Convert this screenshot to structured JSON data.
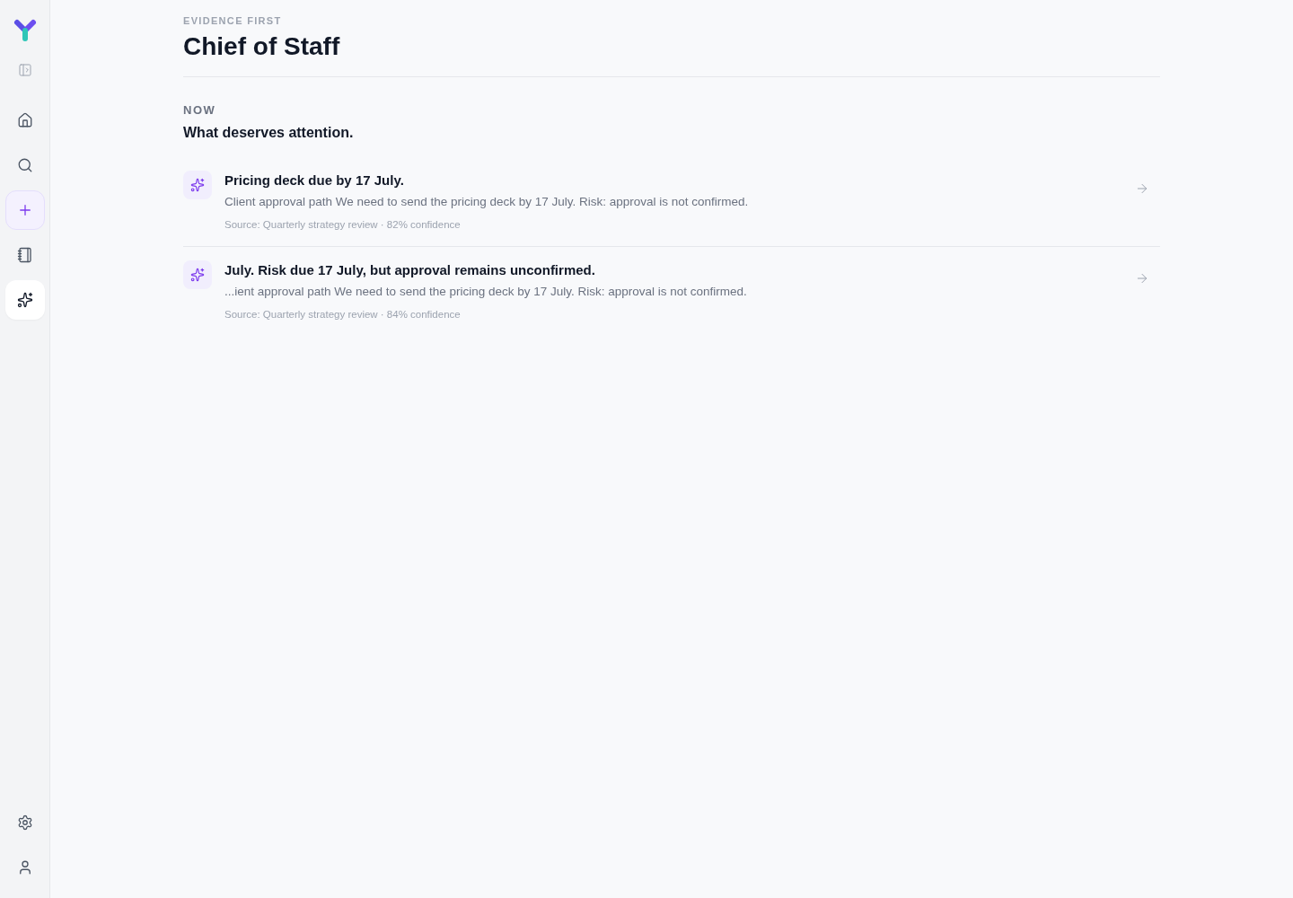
{
  "sidebar": {
    "nav_items": [
      {
        "kind": "toggle",
        "selected": false
      },
      {
        "kind": "link",
        "selected": false
      },
      {
        "kind": "link",
        "selected": false
      },
      {
        "kind": "action",
        "selected": false
      },
      {
        "kind": "link",
        "selected": false
      },
      {
        "kind": "link",
        "selected": true
      }
    ],
    "footer_items": [
      {
        "kind": "link",
        "selected": false
      },
      {
        "kind": "link",
        "selected": false
      }
    ]
  },
  "header": {
    "eyebrow": "EVIDENCE FIRST",
    "title": "Chief of Staff"
  },
  "section": {
    "eyebrow": "NOW",
    "heading": "What deserves attention."
  },
  "items": [
    {
      "title": "Pricing deck due by 17 July.",
      "body": "Client approval path We need to send the pricing deck by 17 July. Risk: approval is not confirmed.",
      "source": "Source: Quarterly strategy review · 82% confidence"
    },
    {
      "title": "July. Risk due 17 July, but approval remains unconfirmed.",
      "body": "...ient approval path We need to send the pricing deck by 17 July. Risk: approval is not confirmed.",
      "source": "Source: Quarterly strategy review · 84% confidence"
    }
  ]
}
